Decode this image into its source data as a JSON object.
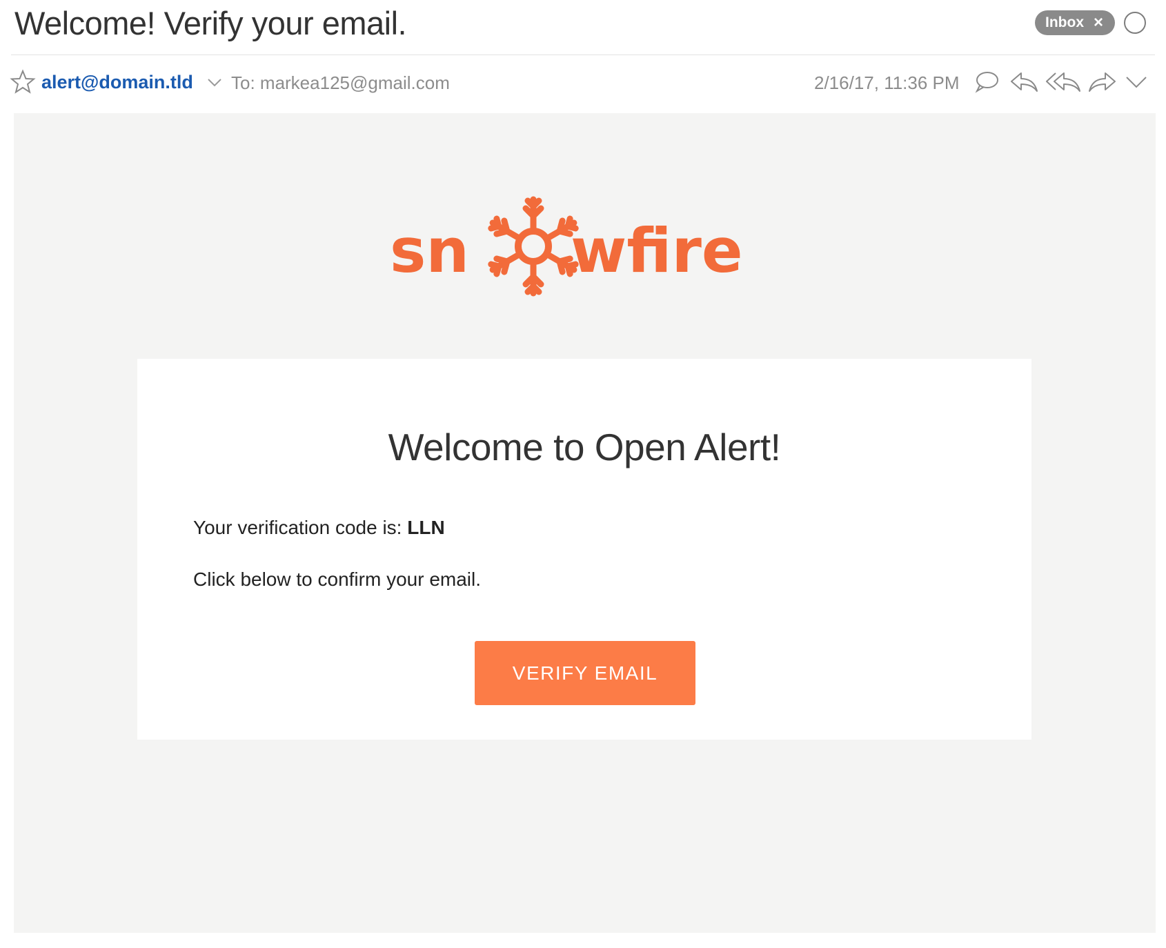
{
  "subject": "Welcome! Verify your email.",
  "labels": {
    "inbox": "Inbox",
    "remove": "×"
  },
  "header": {
    "from": "alert@domain.tld",
    "to": "To: markea125@gmail.com",
    "date": "2/16/17, 11:36 PM",
    "icons": [
      "star-icon",
      "chevron-down-icon",
      "reply-comment-icon",
      "reply-icon",
      "reply-all-icon",
      "forward-icon",
      "more-chevron-icon"
    ]
  },
  "email": {
    "logo": "snowfire",
    "title": "Welcome to Open Alert!",
    "code_prefix": "Your verification code is: ",
    "code": "LLN",
    "instruction": "Click below to confirm your email.",
    "button": "VERIFY EMAIL"
  },
  "colors": {
    "brand": "#f26b3a",
    "button": "#fc7c47",
    "link": "#1b5bb0",
    "body_bg": "#f4f4f3"
  }
}
